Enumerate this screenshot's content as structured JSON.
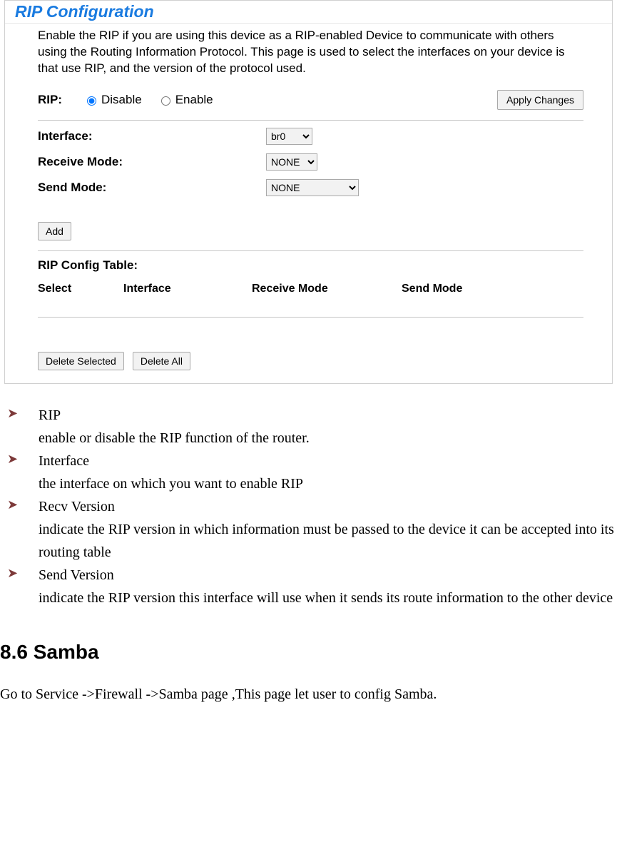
{
  "panel": {
    "title": "RIP Configuration",
    "intro": "Enable the RIP if you are using this device as a RIP-enabled Device to communicate with others using the Routing Information Protocol. This page is used to select the interfaces on your device is that use RIP, and the version of the protocol used.",
    "rip": {
      "label": "RIP:",
      "disable": "Disable",
      "enable": "Enable",
      "apply": "Apply Changes"
    },
    "interface": {
      "label": "Interface:",
      "value": "br0"
    },
    "receiveMode": {
      "label": "Receive Mode:",
      "value": "NONE"
    },
    "sendMode": {
      "label": "Send Mode:",
      "value": "NONE"
    },
    "addBtn": "Add",
    "configTableLabel": "RIP Config Table:",
    "tableHeaders": {
      "c1": "Select",
      "c2": "Interface",
      "c3": "Receive Mode",
      "c4": "Send Mode"
    },
    "deleteSelected": "Delete Selected",
    "deleteAll": "Delete All"
  },
  "bullets": [
    {
      "title": "RIP",
      "desc": "enable or disable the RIP function of the router."
    },
    {
      "title": "Interface",
      "desc": "the interface on which you want to enable RIP"
    },
    {
      "title": "Recv Version",
      "desc": "indicate the RIP version in which information must be passed to the device it can be accepted into its routing table"
    },
    {
      "title": "Send Version",
      "desc": "indicate the RIP version this interface will use when it sends its route information to the other device"
    }
  ],
  "section86": {
    "heading": "8.6 Samba",
    "nav": "Go to Service ->Firewall ->Samba page ,This page let user to config Samba."
  }
}
